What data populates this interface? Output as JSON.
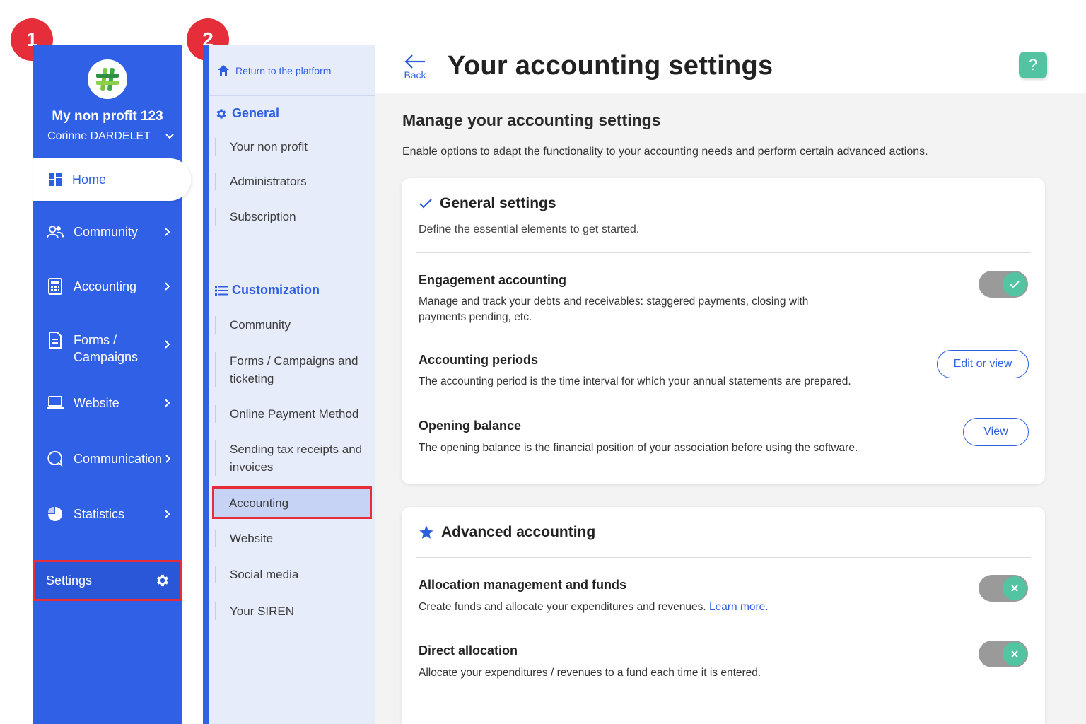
{
  "badges": {
    "primary": "1",
    "secondary": "2"
  },
  "primary_sidebar": {
    "org_name": "My non profit 123",
    "user_name": "Corinne DARDELET",
    "home_label": "Home",
    "items": [
      {
        "label": "Community",
        "icon": "community-icon"
      },
      {
        "label": "Accounting",
        "icon": "calculator-icon"
      },
      {
        "label": "Forms /\nCampaigns",
        "icon": "document-icon"
      },
      {
        "label": "Website",
        "icon": "laptop-icon"
      },
      {
        "label": "Communication",
        "icon": "chat-icon"
      },
      {
        "label": "Statistics",
        "icon": "pie-chart-icon"
      }
    ],
    "settings_label": "Settings"
  },
  "secondary_sidebar": {
    "return_label": "Return to the platform",
    "general": {
      "title": "General",
      "items": [
        "Your non profit",
        "Administrators",
        "Subscription"
      ]
    },
    "customization": {
      "title": "Customization",
      "items": [
        "Community",
        "Forms / Campaigns and ticketing",
        "Online Payment Method",
        "Sending tax receipts and invoices",
        "Accounting",
        "Website",
        "Social media",
        "Your SIREN"
      ],
      "active": "Accounting"
    }
  },
  "header": {
    "back_label": "Back",
    "title": "Your accounting settings",
    "help_label": "?"
  },
  "main": {
    "manage_title": "Manage your accounting settings",
    "manage_desc": "Enable options to adapt the functionality to your accounting needs and perform certain advanced actions.",
    "general_settings": {
      "title": "General settings",
      "subtitle": "Define the essential elements to get started.",
      "engagement": {
        "title": "Engagement accounting",
        "desc": "Manage and track your debts and receivables: staggered payments, closing with payments pending, etc."
      },
      "periods": {
        "title": "Accounting periods",
        "desc": "The accounting period is the time interval for which your annual statements are prepared.",
        "button": "Edit or view"
      },
      "opening": {
        "title": "Opening balance",
        "desc": "The opening balance is the financial position of your association before using the software.",
        "button": "View"
      }
    },
    "advanced": {
      "title": "Advanced accounting",
      "allocation": {
        "title": "Allocation management and funds",
        "desc": "Create funds and allocate your expenditures and revenues.",
        "learn_more": "Learn more."
      },
      "direct": {
        "title": "Direct allocation",
        "desc": "Allocate your expenditures / revenues to a fund each time it is entered."
      }
    }
  },
  "colors": {
    "brand_blue": "#3060e6",
    "accent_green": "#52c4a2",
    "highlight_red": "#e52e3a"
  }
}
